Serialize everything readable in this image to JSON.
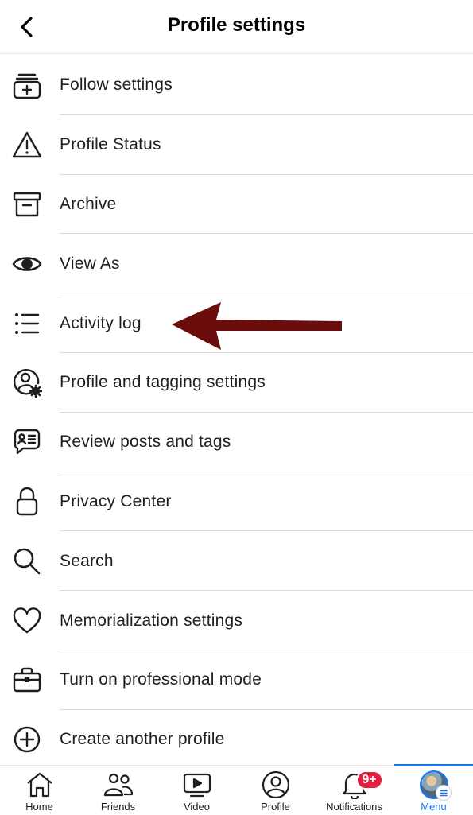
{
  "header": {
    "title": "Profile settings",
    "back_icon": "chevron-left-icon"
  },
  "menu": {
    "items": [
      {
        "label": "Follow settings",
        "icon": "follow-settings-icon"
      },
      {
        "label": "Profile Status",
        "icon": "warning-icon"
      },
      {
        "label": "Archive",
        "icon": "archive-icon"
      },
      {
        "label": "View As",
        "icon": "eye-icon"
      },
      {
        "label": "Activity log",
        "icon": "list-icon"
      },
      {
        "label": "Profile and tagging settings",
        "icon": "profile-gear-icon"
      },
      {
        "label": "Review posts and tags",
        "icon": "review-posts-icon"
      },
      {
        "label": "Privacy Center",
        "icon": "lock-icon"
      },
      {
        "label": "Search",
        "icon": "search-icon"
      },
      {
        "label": "Memorialization settings",
        "icon": "heart-icon"
      },
      {
        "label": "Turn on professional mode",
        "icon": "briefcase-icon"
      },
      {
        "label": "Create another profile",
        "icon": "plus-circle-icon"
      }
    ]
  },
  "annotation": {
    "color": "#6b0d0d",
    "points_to": "Activity log"
  },
  "bottom_nav": {
    "items": [
      {
        "label": "Home",
        "icon": "home-icon"
      },
      {
        "label": "Friends",
        "icon": "friends-icon"
      },
      {
        "label": "Video",
        "icon": "video-icon"
      },
      {
        "label": "Profile",
        "icon": "profile-icon"
      },
      {
        "label": "Notifications",
        "icon": "bell-icon",
        "badge": "9+"
      },
      {
        "label": "Menu",
        "icon": "avatar-menu-icon",
        "active": true
      }
    ]
  },
  "colors": {
    "accent": "#1877f2",
    "badge": "#e41e3f",
    "text": "#1c1e21"
  }
}
